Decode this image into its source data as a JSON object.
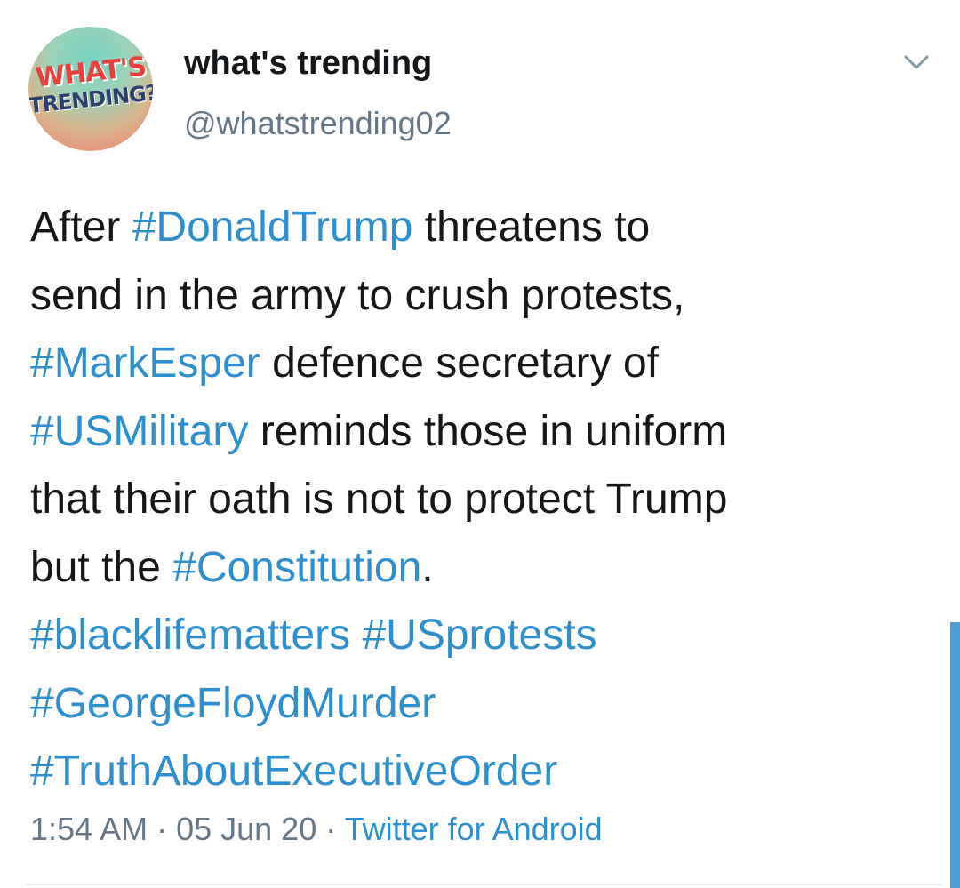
{
  "avatar": {
    "logo_line1": "WHAT'S",
    "logo_line2": "TRENDING?"
  },
  "author": {
    "display_name": "what's trending",
    "handle": "@whatstrending02"
  },
  "menu_icon": "chevron-down-icon",
  "tweet": {
    "l1_a": "After ",
    "l1_tag": "#DonaldTrump",
    "l1_b": " threatens to",
    "l2": "send in the army to crush protests,",
    "l3_tag": "#MarkEsper",
    "l3_b": " defence secretary of",
    "l4_tag": "#USMilitary",
    "l4_b": " reminds those in uniform",
    "l5": "that their oath is not to protect Trump",
    "l6_a": "but the ",
    "l6_tag": "#Constitution",
    "l6_b": ".",
    "l7_tag1": "#blacklifematters",
    "l7_sep": " ",
    "l7_tag2": "#USprotests",
    "l8_tag": "#GeorgeFloydMurder",
    "l9_tag": "#TruthAboutExecutiveOrder"
  },
  "meta": {
    "time": "1:54 AM",
    "sep1": " · ",
    "date": "05 Jun 20",
    "sep2": " · ",
    "source": "Twitter for Android"
  },
  "colors": {
    "text": "#14171a",
    "secondary": "#657786",
    "link": "#2d8fce"
  }
}
